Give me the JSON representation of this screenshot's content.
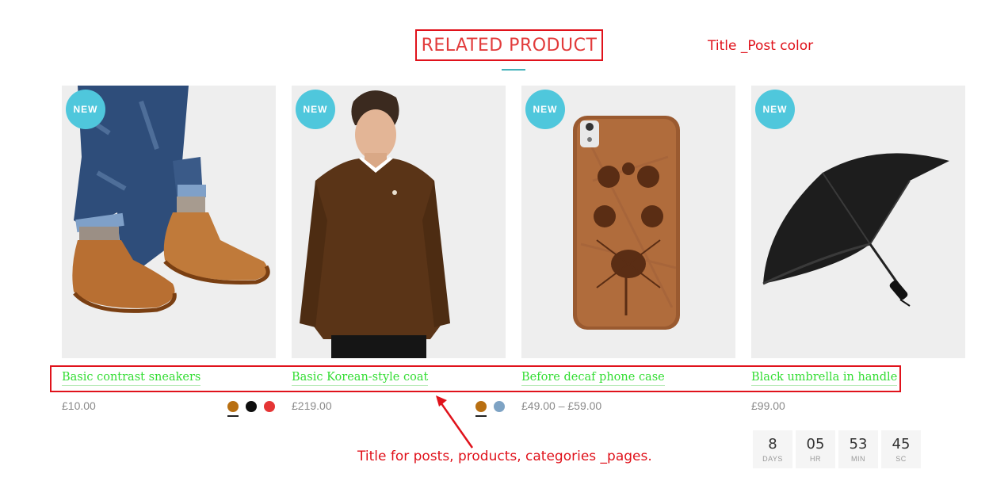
{
  "section": {
    "title": "RELATED PRODUCT"
  },
  "annotations": {
    "title_post_color": "Title _Post color",
    "titles_note": "Title for posts, products, categories _pages."
  },
  "badge_label": "NEW",
  "products": [
    {
      "title": "Basic contrast sneakers",
      "price": "£10.00",
      "image": "sneakers-image",
      "swatches": [
        "#b86f12",
        "#0e0e0e",
        "#e53535"
      ]
    },
    {
      "title": "Basic Korean-style coat",
      "price": "£219.00",
      "image": "sweater-model-image",
      "swatches": [
        "#b86f12",
        "#7ea3c4"
      ]
    },
    {
      "title": "Before decaf phone case",
      "price": "£49.00 – £59.00",
      "image": "wooden-phone-case-image",
      "swatches": []
    },
    {
      "title": "Black umbrella in handle",
      "price": "£99.00",
      "image": "umbrella-image",
      "swatches": []
    }
  ],
  "countdown": [
    {
      "value": "8",
      "label": "DAYS"
    },
    {
      "value": "05",
      "label": "HR"
    },
    {
      "value": "53",
      "label": "MIN"
    },
    {
      "value": "45",
      "label": "SC"
    }
  ],
  "colors": {
    "accent_red": "#e0121b",
    "title_green": "#33dd33",
    "badge_cyan": "#4fc7dc",
    "underline_teal": "#45b3bb"
  }
}
